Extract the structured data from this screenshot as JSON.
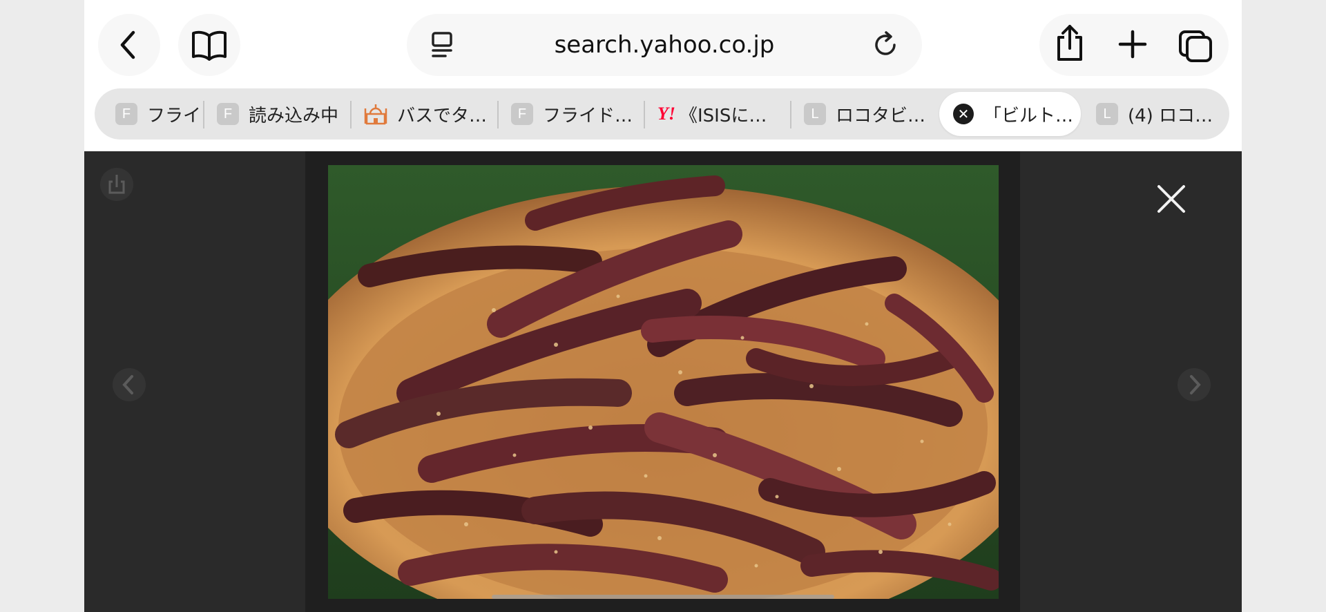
{
  "toolbar": {
    "back_icon": "chevron-left-icon",
    "bookmarks_icon": "book-icon",
    "address": {
      "reader_icon": "page-menu-icon",
      "url": "search.yahoo.co.jp",
      "reload_icon": "reload-icon"
    },
    "share_icon": "share-icon",
    "new_tab_icon": "plus-icon",
    "tabs_overview_icon": "tabs-icon"
  },
  "tabs": [
    {
      "favicon": "F",
      "label": "フライ"
    },
    {
      "favicon": "F",
      "label": "読み込み中"
    },
    {
      "favicon": "mosque",
      "label": "バスでタ…"
    },
    {
      "favicon": "F",
      "label": "フライド…"
    },
    {
      "favicon": "Y!",
      "label": "《ISISに…"
    },
    {
      "favicon": "L",
      "label": "ロコタビ…"
    },
    {
      "favicon": "close",
      "label": "「ビルト…",
      "active": true
    },
    {
      "favicon": "L",
      "label": "(4) ロコ…"
    }
  ],
  "viewer": {
    "image_subject": "biltong dried meat strips in wooden bowl",
    "close_icon": "close-icon",
    "share_icon": "share-icon",
    "prev_icon": "chevron-left-icon",
    "next_icon": "chevron-right-icon"
  },
  "colors": {
    "yahoo_red": "#ff0033",
    "viewer_bg": "#2a2a2a"
  }
}
